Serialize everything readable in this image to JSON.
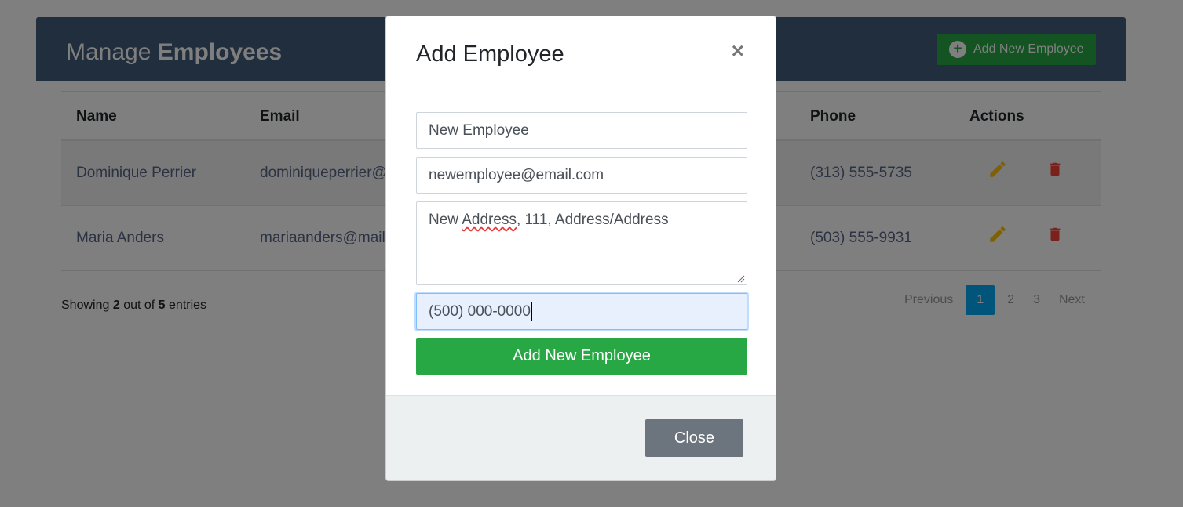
{
  "header": {
    "title_prefix": "Manage",
    "title_bold": "Employees",
    "add_button_label": "Add New Employee"
  },
  "table": {
    "columns": [
      "Name",
      "Email",
      "Phone",
      "Actions"
    ],
    "rows": [
      {
        "name": "Dominique Perrier",
        "email": "dominiqueperrier@mail.com",
        "phone": "(313) 555-5735"
      },
      {
        "name": "Maria Anders",
        "email": "mariaanders@mail.com",
        "phone": "(503) 555-9931"
      }
    ]
  },
  "footer": {
    "showing_prefix": "Showing",
    "shown": "2",
    "out_of": "out of",
    "total": "5",
    "entries": "entries"
  },
  "pagination": {
    "previous": "Previous",
    "pages": [
      "1",
      "2",
      "3"
    ],
    "active_page": "1",
    "next": "Next"
  },
  "modal": {
    "title": "Add Employee",
    "close_x": "×",
    "name_value": "New Employee",
    "email_value": "newemployee@email.com",
    "address_prefix": "New ",
    "address_misspelled": "Address",
    "address_rest": ", 111, Address/Address",
    "phone_value": "(500) 000-0000",
    "submit_label": "Add New Employee",
    "close_label": "Close"
  },
  "colors": {
    "header_bg": "#435d7d",
    "success": "#28a745",
    "active_page": "#03a9f4",
    "edit_icon": "#FFC107",
    "delete_icon": "#F44336",
    "secondary": "#6c757d"
  }
}
